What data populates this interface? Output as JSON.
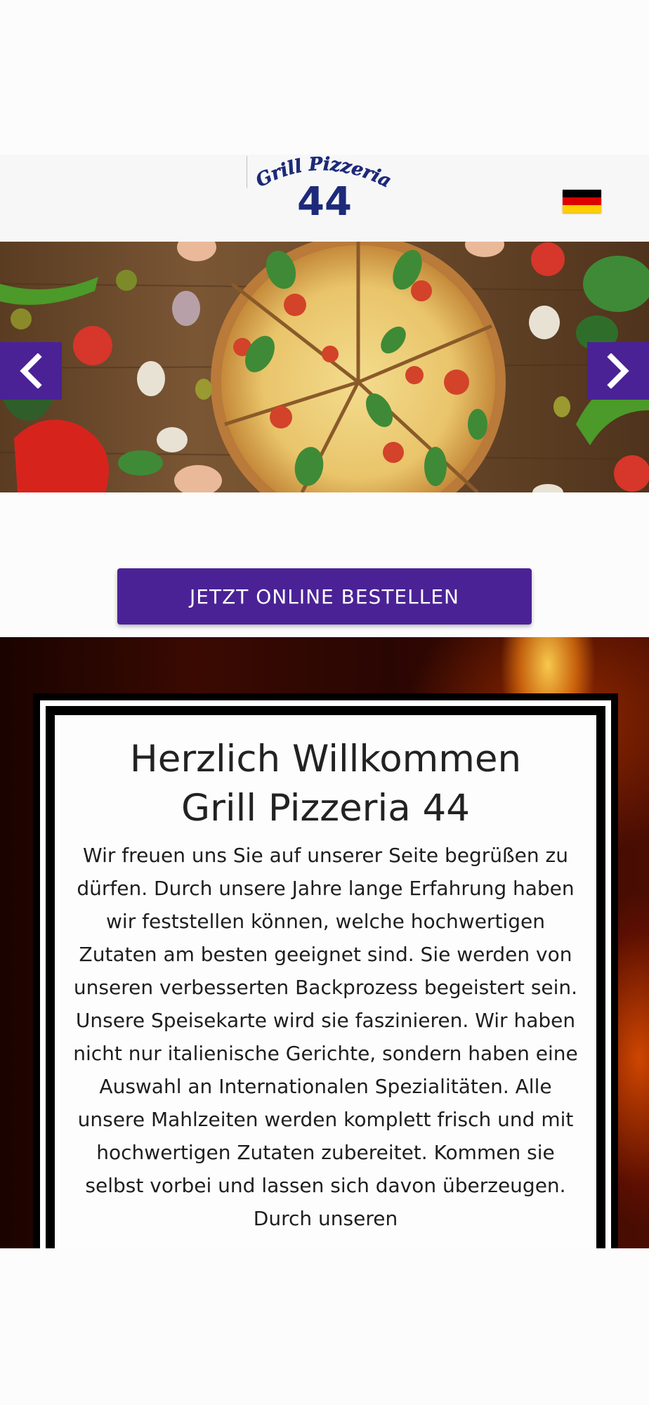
{
  "header": {
    "logo_top_text": "Grill Pizzeria",
    "logo_number": "44",
    "language_flag": "german-flag-icon",
    "flag_colors": [
      "#000000",
      "#dd0000",
      "#ffce00"
    ]
  },
  "hero": {
    "prev_icon": "chevron-left-icon",
    "next_icon": "chevron-right-icon"
  },
  "cta": {
    "label": "JETZT ONLINE BESTELLEN"
  },
  "welcome": {
    "title_line1": "Herzlich Willkommen",
    "title_line2": "Grill Pizzeria 44",
    "body": "Wir freuen uns Sie auf unserer Seite begrüßen zu dürfen. Durch unsere Jahre lange Erfahrung haben wir feststellen können, welche hochwertigen Zutaten am besten geeignet sind. Sie werden von unseren verbesserten Backprozess begeistert sein. Unsere Speisekarte wird sie faszinieren. Wir haben nicht nur italienische Gerichte, sondern haben eine Auswahl an Internationalen Spezialitäten. Alle unsere Mahlzeiten werden komplett frisch und mit hochwertigen Zutaten zubereitet. Kommen sie selbst vorbei und lassen sich davon überzeugen. Durch unseren"
  },
  "colors": {
    "brand_purple": "#4a2296",
    "logo_navy": "#1d2a7a"
  }
}
